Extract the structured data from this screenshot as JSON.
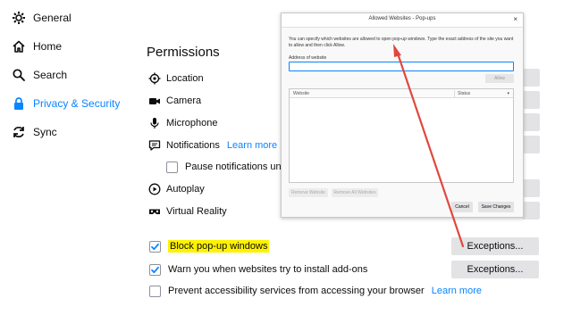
{
  "sidebar": {
    "items": [
      {
        "label": "General",
        "icon": "gear-icon"
      },
      {
        "label": "Home",
        "icon": "home-icon"
      },
      {
        "label": "Search",
        "icon": "search-icon"
      },
      {
        "label": "Privacy & Security",
        "icon": "lock-icon",
        "selected": true
      },
      {
        "label": "Sync",
        "icon": "sync-icon"
      }
    ]
  },
  "permissions": {
    "title": "Permissions",
    "items": [
      {
        "label": "Location",
        "icon": "location-icon"
      },
      {
        "label": "Camera",
        "icon": "camera-icon"
      },
      {
        "label": "Microphone",
        "icon": "microphone-icon"
      },
      {
        "label": "Notifications",
        "icon": "notification-icon",
        "link": "Learn more"
      },
      {
        "label": "Pause notifications until F"
      },
      {
        "label": "Autoplay",
        "icon": "autoplay-icon"
      },
      {
        "label": "Virtual Reality",
        "icon": "vr-icon"
      }
    ]
  },
  "prefs": {
    "block_popups": {
      "label": "Block pop-up windows",
      "checked": true
    },
    "warn_addons": {
      "label": "Warn you when websites try to install add-ons",
      "checked": true
    },
    "prevent_a11y": {
      "label": "Prevent accessibility services from accessing your browser",
      "checked": false,
      "link": "Learn more"
    },
    "exceptions_label": "Exceptions..."
  },
  "dialog": {
    "title": "Allowed Websites - Pop-ups",
    "close": "×",
    "description": "You can specify which websites are allowed to open pop-up windows. Type the exact address of the site you want to allow and then click Allow.",
    "address_label": "Address of website",
    "address_value": "",
    "allow_label": "Allow",
    "col_website": "Website",
    "col_status": "Status",
    "remove_website": "Remove Website",
    "remove_all": "Remove All Websites",
    "cancel": "Cancel",
    "save": "Save Changes"
  },
  "colors": {
    "accent": "#0a84ff",
    "highlight": "#fff200",
    "arrow": "#e0483e"
  }
}
